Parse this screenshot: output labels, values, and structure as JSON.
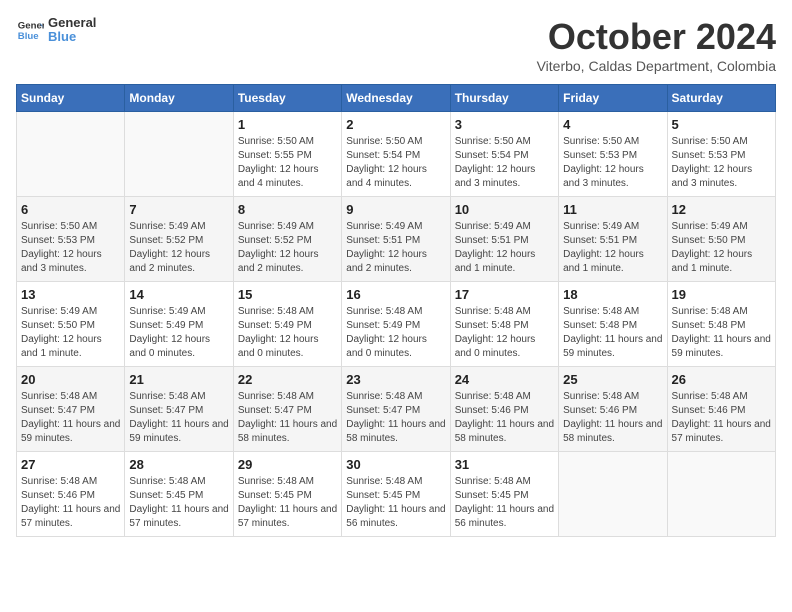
{
  "logo": {
    "line1": "General",
    "line2": "Blue"
  },
  "title": "October 2024",
  "subtitle": "Viterbo, Caldas Department, Colombia",
  "weekdays": [
    "Sunday",
    "Monday",
    "Tuesday",
    "Wednesday",
    "Thursday",
    "Friday",
    "Saturday"
  ],
  "weeks": [
    [
      {
        "day": "",
        "info": ""
      },
      {
        "day": "",
        "info": ""
      },
      {
        "day": "1",
        "info": "Sunrise: 5:50 AM\nSunset: 5:55 PM\nDaylight: 12 hours and 4 minutes."
      },
      {
        "day": "2",
        "info": "Sunrise: 5:50 AM\nSunset: 5:54 PM\nDaylight: 12 hours and 4 minutes."
      },
      {
        "day": "3",
        "info": "Sunrise: 5:50 AM\nSunset: 5:54 PM\nDaylight: 12 hours and 3 minutes."
      },
      {
        "day": "4",
        "info": "Sunrise: 5:50 AM\nSunset: 5:53 PM\nDaylight: 12 hours and 3 minutes."
      },
      {
        "day": "5",
        "info": "Sunrise: 5:50 AM\nSunset: 5:53 PM\nDaylight: 12 hours and 3 minutes."
      }
    ],
    [
      {
        "day": "6",
        "info": "Sunrise: 5:50 AM\nSunset: 5:53 PM\nDaylight: 12 hours and 3 minutes."
      },
      {
        "day": "7",
        "info": "Sunrise: 5:49 AM\nSunset: 5:52 PM\nDaylight: 12 hours and 2 minutes."
      },
      {
        "day": "8",
        "info": "Sunrise: 5:49 AM\nSunset: 5:52 PM\nDaylight: 12 hours and 2 minutes."
      },
      {
        "day": "9",
        "info": "Sunrise: 5:49 AM\nSunset: 5:51 PM\nDaylight: 12 hours and 2 minutes."
      },
      {
        "day": "10",
        "info": "Sunrise: 5:49 AM\nSunset: 5:51 PM\nDaylight: 12 hours and 1 minute."
      },
      {
        "day": "11",
        "info": "Sunrise: 5:49 AM\nSunset: 5:51 PM\nDaylight: 12 hours and 1 minute."
      },
      {
        "day": "12",
        "info": "Sunrise: 5:49 AM\nSunset: 5:50 PM\nDaylight: 12 hours and 1 minute."
      }
    ],
    [
      {
        "day": "13",
        "info": "Sunrise: 5:49 AM\nSunset: 5:50 PM\nDaylight: 12 hours and 1 minute."
      },
      {
        "day": "14",
        "info": "Sunrise: 5:49 AM\nSunset: 5:49 PM\nDaylight: 12 hours and 0 minutes."
      },
      {
        "day": "15",
        "info": "Sunrise: 5:48 AM\nSunset: 5:49 PM\nDaylight: 12 hours and 0 minutes."
      },
      {
        "day": "16",
        "info": "Sunrise: 5:48 AM\nSunset: 5:49 PM\nDaylight: 12 hours and 0 minutes."
      },
      {
        "day": "17",
        "info": "Sunrise: 5:48 AM\nSunset: 5:48 PM\nDaylight: 12 hours and 0 minutes."
      },
      {
        "day": "18",
        "info": "Sunrise: 5:48 AM\nSunset: 5:48 PM\nDaylight: 11 hours and 59 minutes."
      },
      {
        "day": "19",
        "info": "Sunrise: 5:48 AM\nSunset: 5:48 PM\nDaylight: 11 hours and 59 minutes."
      }
    ],
    [
      {
        "day": "20",
        "info": "Sunrise: 5:48 AM\nSunset: 5:47 PM\nDaylight: 11 hours and 59 minutes."
      },
      {
        "day": "21",
        "info": "Sunrise: 5:48 AM\nSunset: 5:47 PM\nDaylight: 11 hours and 59 minutes."
      },
      {
        "day": "22",
        "info": "Sunrise: 5:48 AM\nSunset: 5:47 PM\nDaylight: 11 hours and 58 minutes."
      },
      {
        "day": "23",
        "info": "Sunrise: 5:48 AM\nSunset: 5:47 PM\nDaylight: 11 hours and 58 minutes."
      },
      {
        "day": "24",
        "info": "Sunrise: 5:48 AM\nSunset: 5:46 PM\nDaylight: 11 hours and 58 minutes."
      },
      {
        "day": "25",
        "info": "Sunrise: 5:48 AM\nSunset: 5:46 PM\nDaylight: 11 hours and 58 minutes."
      },
      {
        "day": "26",
        "info": "Sunrise: 5:48 AM\nSunset: 5:46 PM\nDaylight: 11 hours and 57 minutes."
      }
    ],
    [
      {
        "day": "27",
        "info": "Sunrise: 5:48 AM\nSunset: 5:46 PM\nDaylight: 11 hours and 57 minutes."
      },
      {
        "day": "28",
        "info": "Sunrise: 5:48 AM\nSunset: 5:45 PM\nDaylight: 11 hours and 57 minutes."
      },
      {
        "day": "29",
        "info": "Sunrise: 5:48 AM\nSunset: 5:45 PM\nDaylight: 11 hours and 57 minutes."
      },
      {
        "day": "30",
        "info": "Sunrise: 5:48 AM\nSunset: 5:45 PM\nDaylight: 11 hours and 56 minutes."
      },
      {
        "day": "31",
        "info": "Sunrise: 5:48 AM\nSunset: 5:45 PM\nDaylight: 11 hours and 56 minutes."
      },
      {
        "day": "",
        "info": ""
      },
      {
        "day": "",
        "info": ""
      }
    ]
  ]
}
